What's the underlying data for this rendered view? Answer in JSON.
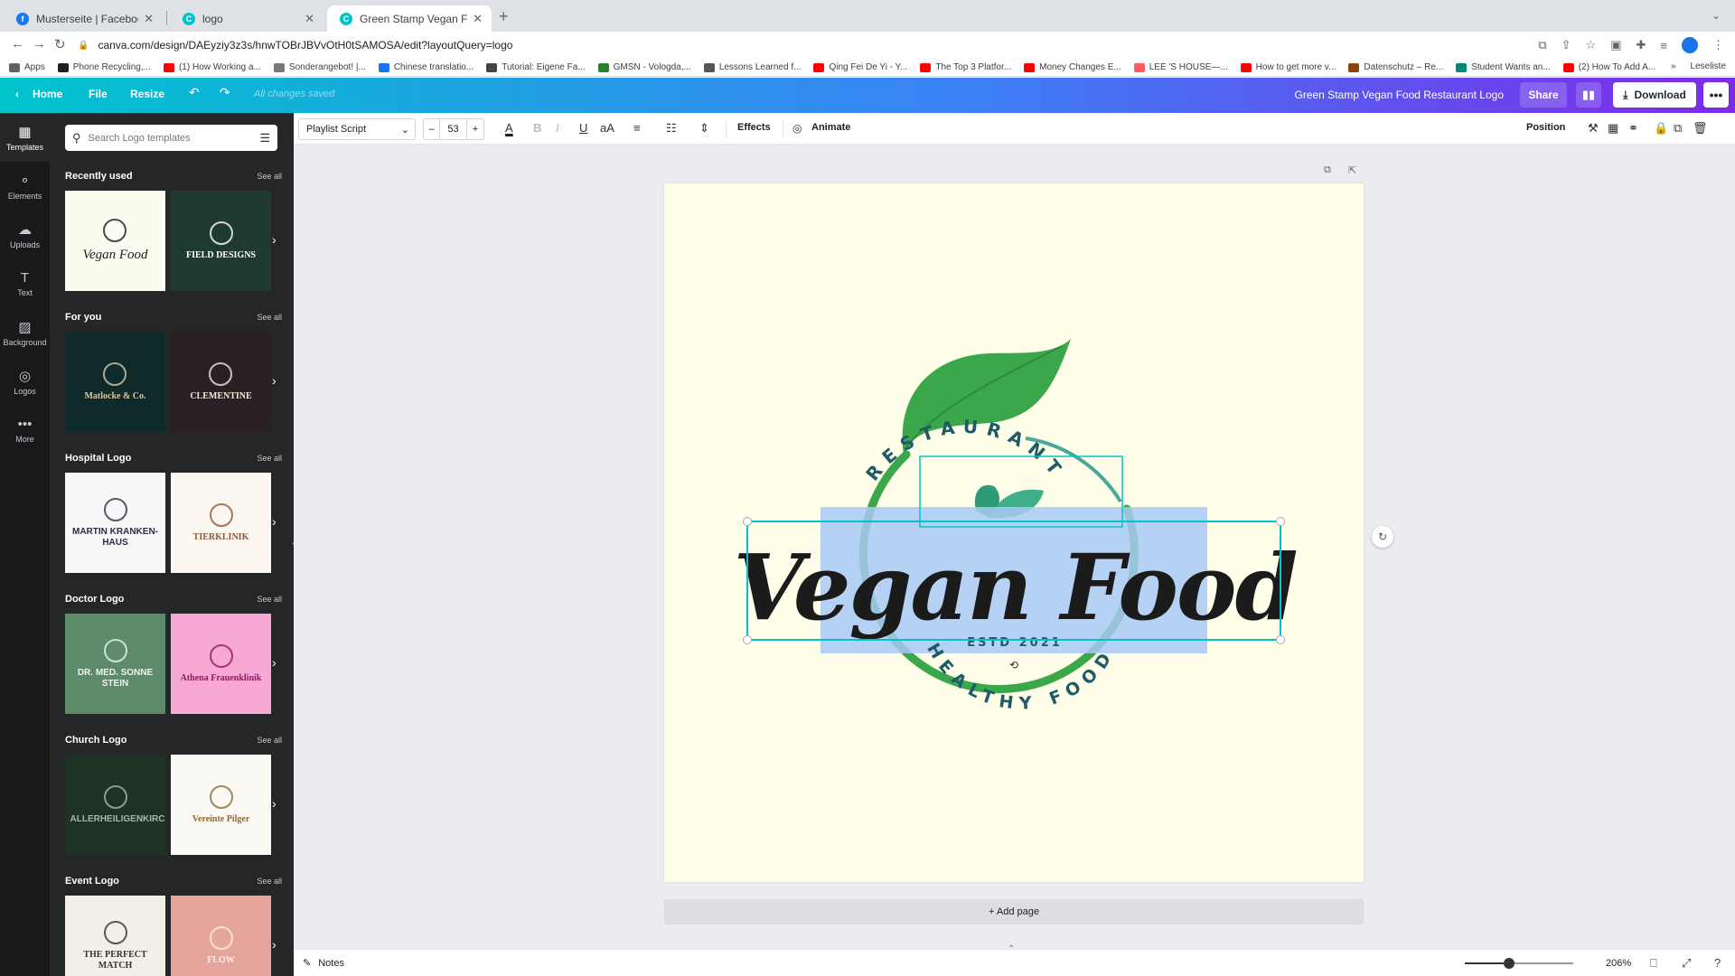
{
  "browser": {
    "tabs": [
      {
        "title": "Musterseite | Facebook",
        "favicon_color": "#1877f2",
        "active": false
      },
      {
        "title": "logo",
        "favicon_color": "#00c4cc",
        "active": false
      },
      {
        "title": "Green Stamp Vegan Food Rest",
        "favicon_color": "#00c4cc",
        "active": true
      }
    ],
    "url": "canva.com/design/DAEyziy3z3s/hnwTOBrJBVvOtH0tSAMOSA/edit?layoutQuery=logo",
    "bookmarks": [
      {
        "label": "Apps",
        "color": "#5f6368"
      },
      {
        "label": "Phone Recycling,...",
        "color": "#202124"
      },
      {
        "label": "(1) How Working a...",
        "color": "#ff0000"
      },
      {
        "label": "Sonderangebot! |...",
        "color": "#777777"
      },
      {
        "label": "Chinese translatio...",
        "color": "#1a73e8"
      },
      {
        "label": "Tutorial: Eigene Fa...",
        "color": "#444444"
      },
      {
        "label": "GMSN - Vologda,...",
        "color": "#2e7d32"
      },
      {
        "label": "Lessons Learned f...",
        "color": "#555555"
      },
      {
        "label": "Qing Fei De Yi - Y...",
        "color": "#ff0000"
      },
      {
        "label": "The Top 3 Platfor...",
        "color": "#ff0000"
      },
      {
        "label": "Money Changes E...",
        "color": "#ff0000"
      },
      {
        "label": "LEE 'S HOUSE—...",
        "color": "#ff5a5f"
      },
      {
        "label": "How to get more v...",
        "color": "#ff0000"
      },
      {
        "label": "Datenschutz – Re...",
        "color": "#8b4513"
      },
      {
        "label": "Student Wants an...",
        "color": "#00897b"
      },
      {
        "label": "(2) How To Add A...",
        "color": "#ff0000"
      }
    ],
    "more_bookmarks": "»",
    "reading_list": "Leseliste"
  },
  "header": {
    "home": "Home",
    "file": "File",
    "resize": "Resize",
    "status": "All changes saved",
    "design_title": "Green Stamp Vegan Food Restaurant Logo",
    "share": "Share",
    "download": "Download",
    "more": "•••"
  },
  "rail": [
    {
      "label": "Templates",
      "icon": "▦",
      "active": true
    },
    {
      "label": "Elements",
      "icon": "⚬",
      "active": false
    },
    {
      "label": "Uploads",
      "icon": "☁",
      "active": false
    },
    {
      "label": "Text",
      "icon": "T",
      "active": false
    },
    {
      "label": "Background",
      "icon": "▨",
      "active": false
    },
    {
      "label": "Logos",
      "icon": "◎",
      "active": false
    },
    {
      "label": "More",
      "icon": "•••",
      "active": false
    }
  ],
  "panel": {
    "search_placeholder": "Search Logo templates",
    "see_all": "See all",
    "sections": [
      {
        "title": "Recently used",
        "thumbs": [
          {
            "bg": "#fbfbf0",
            "text": "Vegan Food",
            "color": "#1e1e1e",
            "font": "serif-italic",
            "mark": "leaf"
          },
          {
            "bg": "#1f3b2f",
            "text": "FIELD DESIGNS",
            "color": "#ffffff",
            "font": "serif",
            "mark": "tree"
          }
        ]
      },
      {
        "title": "For you",
        "thumbs": [
          {
            "bg": "#0f2a2b",
            "text": "Matlocke & Co.",
            "color": "#d9c7a2",
            "font": "serif",
            "mark": "globe"
          },
          {
            "bg": "#2a1f24",
            "text": "CLEMENTINE",
            "color": "#f3e9d8",
            "font": "serif",
            "mark": "badge"
          }
        ]
      },
      {
        "title": "Hospital Logo",
        "thumbs": [
          {
            "bg": "#f7f7f7",
            "text": "MARTIN KRANKEN-HAUS",
            "color": "#2b2f45",
            "font": "sans",
            "mark": "cross"
          },
          {
            "bg": "#fbf6f0",
            "text": "TIERKLINIK",
            "color": "#8a5a3a",
            "font": "serif",
            "mark": "arch"
          }
        ]
      },
      {
        "title": "Doctor Logo",
        "thumbs": [
          {
            "bg": "#5c8a6a",
            "text": "DR. MED. SONNE STEIN",
            "color": "#eef5ef",
            "font": "sans",
            "mark": "caduceus"
          },
          {
            "bg": "#f7a8d4",
            "text": "Athena Frauenklinik",
            "color": "#8e1a62",
            "font": "serif",
            "mark": "flower"
          }
        ]
      },
      {
        "title": "Church Logo",
        "thumbs": [
          {
            "bg": "#1e3324",
            "text": "ALLERHEILIGENKIRCHE",
            "color": "#a8b8a0",
            "font": "sans",
            "mark": "cross-small"
          },
          {
            "bg": "#fbf9f4",
            "text": "Vereinte Pilger",
            "color": "#8a6a3a",
            "font": "serif",
            "mark": "church"
          }
        ]
      },
      {
        "title": "Event Logo",
        "thumbs": [
          {
            "bg": "#f2efe6",
            "text": "THE PERFECT MATCH",
            "color": "#333333",
            "font": "serif",
            "mark": "rings"
          },
          {
            "bg": "#e6a59b",
            "text": "FLOW",
            "color": "#fbefe9",
            "font": "serif",
            "mark": "ring"
          }
        ]
      }
    ]
  },
  "toolbar": {
    "font": "Playlist Script",
    "size_minus": "–",
    "size": "53",
    "size_plus": "+",
    "effects": "Effects",
    "animate": "Animate",
    "position": "Position"
  },
  "canvas": {
    "arc_top": "RESTAURANT",
    "script": "Vegan Food",
    "estd": "ESTD 2021",
    "arc_bottom": "HEALTHY FOOD",
    "colors": {
      "green": "#3aa84a",
      "teal": "#1f6f5a",
      "ink": "#1b1b1b",
      "selection": "#00c4cc",
      "highlight": "#a8c9f5",
      "bg": "#fefee9"
    }
  },
  "editor": {
    "add_page": "+ Add page",
    "notes": "Notes",
    "zoom": "206%",
    "zoom_fraction": 0.41
  }
}
